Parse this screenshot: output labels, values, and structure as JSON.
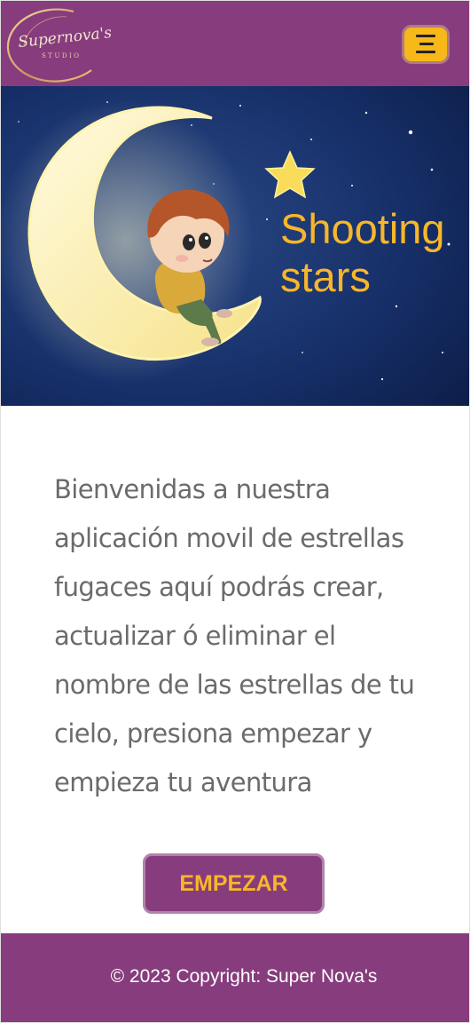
{
  "brand": {
    "name": "Supernova's",
    "subtitle": "STUDIO"
  },
  "navbar": {
    "menu_icon": "hamburger-menu-icon"
  },
  "hero": {
    "title_line1": "Shooting",
    "title_line2": "stars"
  },
  "intro": {
    "lines": [
      "Bienvenidas a nuestra",
      "aplicación movil de estrellas",
      "fugaces aquí podrás crear,",
      "actualizar ó eliminar  el",
      "nombre de las estrellas de tu",
      "cielo,  presiona empezar y",
      "empieza tu aventura"
    ]
  },
  "actions": {
    "start_label": "EMPEZAR"
  },
  "footer": {
    "copyright": "© 2023 Copyright: Super Nova's"
  },
  "colors": {
    "brand_purple": "#873c7d",
    "accent_yellow": "#f8b62a",
    "text_gray": "#6b6b6b"
  }
}
